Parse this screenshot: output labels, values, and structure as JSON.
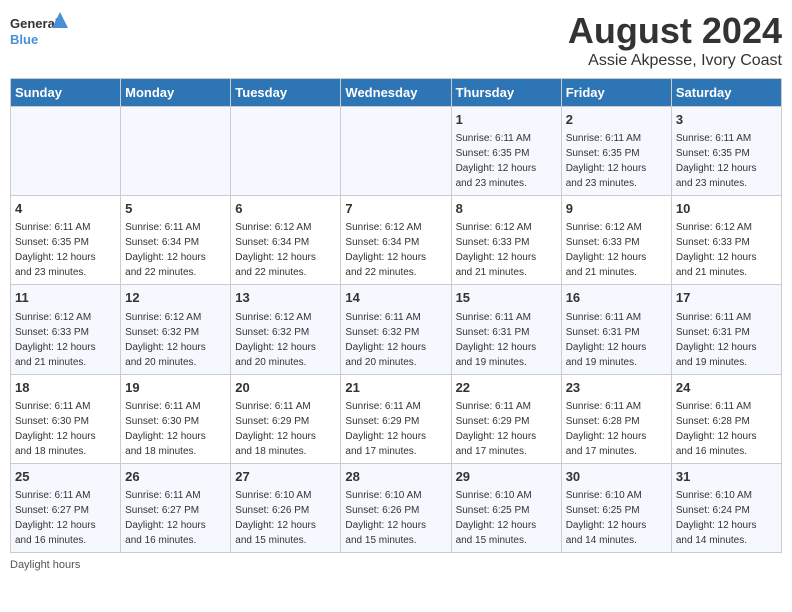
{
  "logo": {
    "general": "General",
    "blue": "Blue"
  },
  "title": "August 2024",
  "subtitle": "Assie Akpesse, Ivory Coast",
  "footer": "Daylight hours",
  "days_of_week": [
    "Sunday",
    "Monday",
    "Tuesday",
    "Wednesday",
    "Thursday",
    "Friday",
    "Saturday"
  ],
  "weeks": [
    [
      {
        "day": "",
        "info": ""
      },
      {
        "day": "",
        "info": ""
      },
      {
        "day": "",
        "info": ""
      },
      {
        "day": "",
        "info": ""
      },
      {
        "day": "1",
        "info": "Sunrise: 6:11 AM\nSunset: 6:35 PM\nDaylight: 12 hours\nand 23 minutes."
      },
      {
        "day": "2",
        "info": "Sunrise: 6:11 AM\nSunset: 6:35 PM\nDaylight: 12 hours\nand 23 minutes."
      },
      {
        "day": "3",
        "info": "Sunrise: 6:11 AM\nSunset: 6:35 PM\nDaylight: 12 hours\nand 23 minutes."
      }
    ],
    [
      {
        "day": "4",
        "info": "Sunrise: 6:11 AM\nSunset: 6:35 PM\nDaylight: 12 hours\nand 23 minutes."
      },
      {
        "day": "5",
        "info": "Sunrise: 6:11 AM\nSunset: 6:34 PM\nDaylight: 12 hours\nand 22 minutes."
      },
      {
        "day": "6",
        "info": "Sunrise: 6:12 AM\nSunset: 6:34 PM\nDaylight: 12 hours\nand 22 minutes."
      },
      {
        "day": "7",
        "info": "Sunrise: 6:12 AM\nSunset: 6:34 PM\nDaylight: 12 hours\nand 22 minutes."
      },
      {
        "day": "8",
        "info": "Sunrise: 6:12 AM\nSunset: 6:33 PM\nDaylight: 12 hours\nand 21 minutes."
      },
      {
        "day": "9",
        "info": "Sunrise: 6:12 AM\nSunset: 6:33 PM\nDaylight: 12 hours\nand 21 minutes."
      },
      {
        "day": "10",
        "info": "Sunrise: 6:12 AM\nSunset: 6:33 PM\nDaylight: 12 hours\nand 21 minutes."
      }
    ],
    [
      {
        "day": "11",
        "info": "Sunrise: 6:12 AM\nSunset: 6:33 PM\nDaylight: 12 hours\nand 21 minutes."
      },
      {
        "day": "12",
        "info": "Sunrise: 6:12 AM\nSunset: 6:32 PM\nDaylight: 12 hours\nand 20 minutes."
      },
      {
        "day": "13",
        "info": "Sunrise: 6:12 AM\nSunset: 6:32 PM\nDaylight: 12 hours\nand 20 minutes."
      },
      {
        "day": "14",
        "info": "Sunrise: 6:11 AM\nSunset: 6:32 PM\nDaylight: 12 hours\nand 20 minutes."
      },
      {
        "day": "15",
        "info": "Sunrise: 6:11 AM\nSunset: 6:31 PM\nDaylight: 12 hours\nand 19 minutes."
      },
      {
        "day": "16",
        "info": "Sunrise: 6:11 AM\nSunset: 6:31 PM\nDaylight: 12 hours\nand 19 minutes."
      },
      {
        "day": "17",
        "info": "Sunrise: 6:11 AM\nSunset: 6:31 PM\nDaylight: 12 hours\nand 19 minutes."
      }
    ],
    [
      {
        "day": "18",
        "info": "Sunrise: 6:11 AM\nSunset: 6:30 PM\nDaylight: 12 hours\nand 18 minutes."
      },
      {
        "day": "19",
        "info": "Sunrise: 6:11 AM\nSunset: 6:30 PM\nDaylight: 12 hours\nand 18 minutes."
      },
      {
        "day": "20",
        "info": "Sunrise: 6:11 AM\nSunset: 6:29 PM\nDaylight: 12 hours\nand 18 minutes."
      },
      {
        "day": "21",
        "info": "Sunrise: 6:11 AM\nSunset: 6:29 PM\nDaylight: 12 hours\nand 17 minutes."
      },
      {
        "day": "22",
        "info": "Sunrise: 6:11 AM\nSunset: 6:29 PM\nDaylight: 12 hours\nand 17 minutes."
      },
      {
        "day": "23",
        "info": "Sunrise: 6:11 AM\nSunset: 6:28 PM\nDaylight: 12 hours\nand 17 minutes."
      },
      {
        "day": "24",
        "info": "Sunrise: 6:11 AM\nSunset: 6:28 PM\nDaylight: 12 hours\nand 16 minutes."
      }
    ],
    [
      {
        "day": "25",
        "info": "Sunrise: 6:11 AM\nSunset: 6:27 PM\nDaylight: 12 hours\nand 16 minutes."
      },
      {
        "day": "26",
        "info": "Sunrise: 6:11 AM\nSunset: 6:27 PM\nDaylight: 12 hours\nand 16 minutes."
      },
      {
        "day": "27",
        "info": "Sunrise: 6:10 AM\nSunset: 6:26 PM\nDaylight: 12 hours\nand 15 minutes."
      },
      {
        "day": "28",
        "info": "Sunrise: 6:10 AM\nSunset: 6:26 PM\nDaylight: 12 hours\nand 15 minutes."
      },
      {
        "day": "29",
        "info": "Sunrise: 6:10 AM\nSunset: 6:25 PM\nDaylight: 12 hours\nand 15 minutes."
      },
      {
        "day": "30",
        "info": "Sunrise: 6:10 AM\nSunset: 6:25 PM\nDaylight: 12 hours\nand 14 minutes."
      },
      {
        "day": "31",
        "info": "Sunrise: 6:10 AM\nSunset: 6:24 PM\nDaylight: 12 hours\nand 14 minutes."
      }
    ]
  ]
}
